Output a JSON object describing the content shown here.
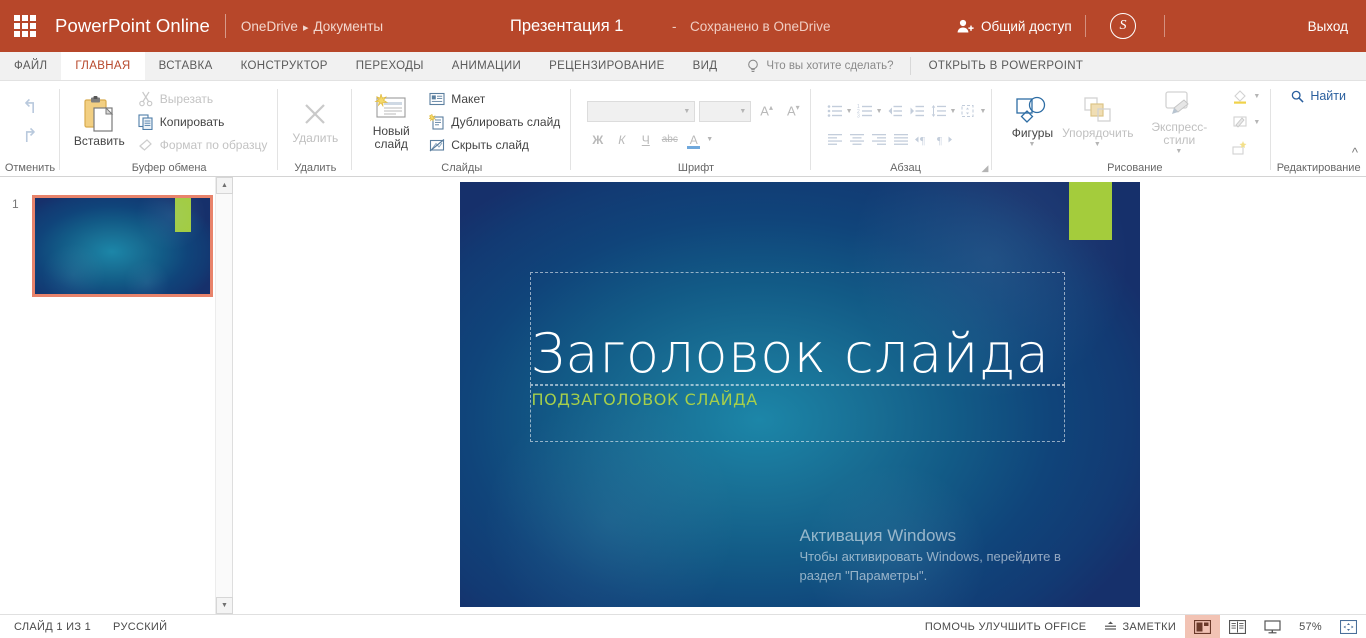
{
  "topbar": {
    "waffle_icon": "app-launcher-icon",
    "brand": "PowerPoint Online",
    "breadcrumb_root": "OneDrive",
    "breadcrumb_sep": "▸",
    "breadcrumb_leaf": "Документы",
    "doc_title": "Презентация 1",
    "dash": "-",
    "saved_state": "Сохранено в OneDrive",
    "share_label": "Общий доступ",
    "skype_glyph": "S",
    "signout": "Выход",
    "bg_color": "#b7472a"
  },
  "tabs": {
    "items": [
      {
        "label": "ФАЙЛ",
        "active": false
      },
      {
        "label": "ГЛАВНАЯ",
        "active": true
      },
      {
        "label": "ВСТАВКА",
        "active": false
      },
      {
        "label": "КОНСТРУКТОР",
        "active": false
      },
      {
        "label": "ПЕРЕХОДЫ",
        "active": false
      },
      {
        "label": "АНИМАЦИИ",
        "active": false
      },
      {
        "label": "РЕЦЕНЗИРОВАНИЕ",
        "active": false
      },
      {
        "label": "ВИД",
        "active": false
      }
    ],
    "tellme": "Что вы хотите сделать?",
    "tellme_icon": "lightbulb-icon",
    "open_in_powerpoint": "ОТКРЫТЬ В POWERPOINT",
    "active_accent": "#b7472a"
  },
  "ribbon": {
    "undo": {
      "caption": "Отменить",
      "undo_icon": "undo-arrow-icon",
      "redo_icon": "redo-arrow-icon"
    },
    "clipboard": {
      "caption": "Буфер обмена",
      "paste": "Вставить",
      "cut": "Вырезать",
      "copy": "Копировать",
      "format_painter": "Формат по образцу"
    },
    "delete": {
      "caption": "Удалить",
      "label": "Удалить"
    },
    "slides": {
      "caption": "Слайды",
      "new_slide": "Новый слайд",
      "layout": "Макет",
      "duplicate": "Дублировать слайд",
      "hide": "Скрыть слайд"
    },
    "font": {
      "caption": "Шрифт",
      "name_value": "",
      "size_value": "",
      "grow": "A",
      "shrink": "A",
      "bold": "Ж",
      "italic": "К",
      "underline": "Ч",
      "strike": "abc",
      "color": "A"
    },
    "paragraph": {
      "caption": "Абзац"
    },
    "drawing": {
      "caption": "Рисование",
      "shapes": "Фигуры",
      "arrange": "Упорядочить",
      "quick_styles": "Экспресс-стили"
    },
    "editing": {
      "caption": "Редактирование",
      "find": "Найти",
      "find_icon": "search-icon"
    },
    "collapse_icon": "chevron-up-icon"
  },
  "thumbnails": {
    "slides": [
      {
        "number": "1",
        "selected": true
      }
    ],
    "selection_color": "#e8836b",
    "scroll_up_icon": "triangle-up-icon",
    "scroll_down_icon": "triangle-down-icon"
  },
  "slide": {
    "title": "Заголовок слайда",
    "subtitle": "ПОДЗАГОЛОВОК СЛАЙДА",
    "title_color": "#ffffff",
    "subtitle_color": "#a6cf4a",
    "accent_rect_color": "#a4cc3c",
    "bg_center_color": "#1c86a8",
    "bg_edge_color": "#16306b"
  },
  "watermark": {
    "title": "Активация Windows",
    "line1": "Чтобы активировать Windows, перейдите в",
    "line2": "раздел \"Параметры\"."
  },
  "status": {
    "slide_count": "СЛАЙД 1 ИЗ 1",
    "language": "РУССКИЙ",
    "improve_office": "ПОМОЧЬ УЛУЧШИТЬ OFFICE",
    "notes": "ЗАМЕТКИ",
    "notes_icon": "notes-icon",
    "view_normal_icon": "normal-view-icon",
    "view_reading_icon": "reading-view-icon",
    "view_slideshow_icon": "slideshow-icon",
    "zoom": "57%",
    "fit_icon": "fit-to-window-icon",
    "selected_view_bg": "#f2c3b4"
  }
}
